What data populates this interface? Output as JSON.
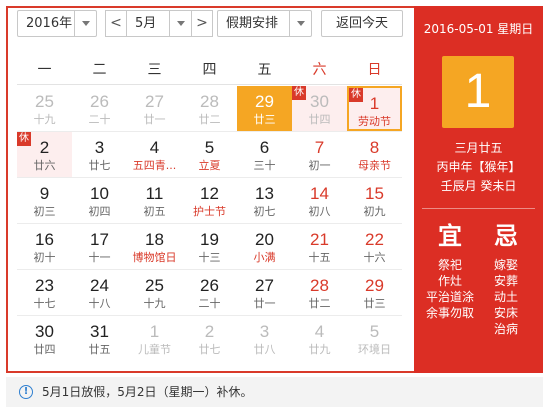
{
  "toolbar": {
    "year": "2016年",
    "prev": "<",
    "month": "5月",
    "next": ">",
    "holiday_select": "假期安排",
    "today_button": "返回今天"
  },
  "weekdays": [
    "一",
    "二",
    "三",
    "四",
    "五",
    "六",
    "日"
  ],
  "days": [
    {
      "d": "25",
      "l": "十九",
      "other": true
    },
    {
      "d": "26",
      "l": "二十",
      "other": true
    },
    {
      "d": "27",
      "l": "廿一",
      "other": true
    },
    {
      "d": "28",
      "l": "廿二",
      "other": true
    },
    {
      "d": "29",
      "l": "廿三",
      "selected": true
    },
    {
      "d": "30",
      "l": "廿四",
      "other": true,
      "xiu": true,
      "holiday": true
    },
    {
      "d": "1",
      "l": "劳动节",
      "xiu": true,
      "holiday": true,
      "today": true,
      "fest": true,
      "wk": true
    },
    {
      "d": "2",
      "l": "廿六",
      "xiu": true,
      "holiday": true
    },
    {
      "d": "3",
      "l": "廿七"
    },
    {
      "d": "4",
      "l": "五四青...",
      "fest": true
    },
    {
      "d": "5",
      "l": "立夏",
      "fest": true
    },
    {
      "d": "6",
      "l": "三十"
    },
    {
      "d": "7",
      "l": "初一",
      "wk": true
    },
    {
      "d": "8",
      "l": "母亲节",
      "wk": true,
      "fest": true
    },
    {
      "d": "9",
      "l": "初三"
    },
    {
      "d": "10",
      "l": "初四"
    },
    {
      "d": "11",
      "l": "初五"
    },
    {
      "d": "12",
      "l": "护士节",
      "fest": true
    },
    {
      "d": "13",
      "l": "初七"
    },
    {
      "d": "14",
      "l": "初八",
      "wk": true
    },
    {
      "d": "15",
      "l": "初九",
      "wk": true
    },
    {
      "d": "16",
      "l": "初十"
    },
    {
      "d": "17",
      "l": "十一"
    },
    {
      "d": "18",
      "l": "博物馆日",
      "fest": true
    },
    {
      "d": "19",
      "l": "十三"
    },
    {
      "d": "20",
      "l": "小满",
      "fest": true
    },
    {
      "d": "21",
      "l": "十五",
      "wk": true
    },
    {
      "d": "22",
      "l": "十六",
      "wk": true
    },
    {
      "d": "23",
      "l": "十七"
    },
    {
      "d": "24",
      "l": "十八"
    },
    {
      "d": "25",
      "l": "十九"
    },
    {
      "d": "26",
      "l": "二十"
    },
    {
      "d": "27",
      "l": "廿一"
    },
    {
      "d": "28",
      "l": "廿二",
      "wk": true
    },
    {
      "d": "29",
      "l": "廿三",
      "wk": true
    },
    {
      "d": "30",
      "l": "廿四"
    },
    {
      "d": "31",
      "l": "廿五"
    },
    {
      "d": "1",
      "l": "儿童节",
      "other": true
    },
    {
      "d": "2",
      "l": "廿七",
      "other": true
    },
    {
      "d": "3",
      "l": "廿八",
      "other": true
    },
    {
      "d": "4",
      "l": "廿九",
      "other": true
    },
    {
      "d": "5",
      "l": "环境日",
      "other": true
    }
  ],
  "xiu_label": "休",
  "panel": {
    "date_line": "2016-05-01 星期日",
    "day": "1",
    "lunar": "三月廿五",
    "ganzhi_year": "丙申年【猴年】",
    "ganzhi_month_day": "壬辰月 癸未日",
    "yi_title": "宜",
    "yi": [
      "祭祀",
      "作灶",
      "平治道涂",
      "余事勿取"
    ],
    "ji_title": "忌",
    "ji": [
      "嫁娶",
      "安葬",
      "动土",
      "安床",
      "治病"
    ]
  },
  "footer": {
    "icon": "info-icon",
    "text": "5月1日放假，5月2日（星期一）补休。"
  },
  "colors": {
    "accent_red": "#d93a2a",
    "panel_red": "#dc2e24",
    "selected_orange": "#f5a623",
    "holiday_pink": "#fdeeee"
  }
}
